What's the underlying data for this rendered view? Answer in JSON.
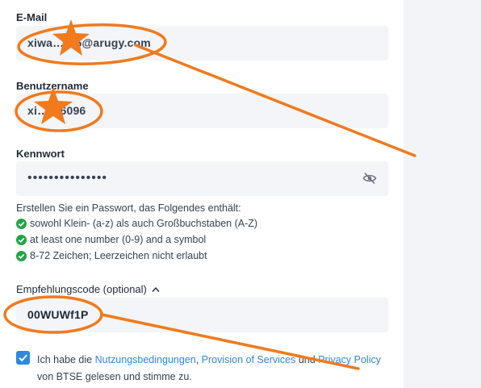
{
  "email": {
    "label": "E-Mail",
    "value": "xiwa……6@arugy.com"
  },
  "username": {
    "label": "Benutzername",
    "value": "xi……6096"
  },
  "password": {
    "label": "Kennwort",
    "value": "•••••••••••••••",
    "visibility_icon": "eye-slash-icon"
  },
  "requirements": {
    "intro": "Erstellen Sie ein Passwort, das Folgendes enthält:",
    "items": [
      "sowohl Klein- (a-z) als auch Großbuchstaben (A-Z)",
      "at least one number (0-9) and a symbol",
      "8-72 Zeichen; Leerzeichen nicht erlaubt"
    ]
  },
  "referral": {
    "label": "Empfehlungscode (optional)",
    "value": "00WUWf1P"
  },
  "terms": {
    "prefix": "Ich habe die ",
    "link1": "Nutzungsbedingungen",
    "sep1": ", ",
    "link2": "Provision of Services",
    "sep2": " und ",
    "link3": "Privacy Policy",
    "suffix": " von BTSE gelesen und stimme zu."
  },
  "colors": {
    "accent": "#2e88dd",
    "success": "#21a546",
    "annotation": "#f07a1c",
    "field_bg": "#f3f5f8"
  }
}
